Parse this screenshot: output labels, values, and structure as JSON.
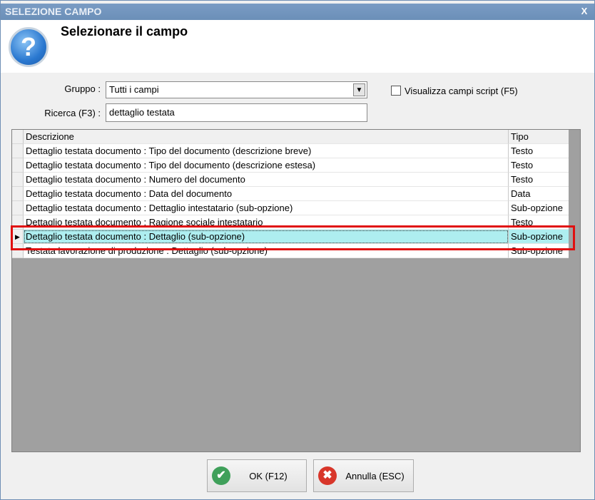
{
  "window": {
    "title": "SELEZIONE CAMPO",
    "close": "X"
  },
  "header": {
    "title": "Selezionare il campo",
    "icon": "question-icon",
    "icon_glyph": "?"
  },
  "form": {
    "group_label": "Gruppo :",
    "group_value": "Tutti i campi",
    "search_label": "Ricerca (F3) :",
    "search_value": "dettaglio testata",
    "script_label": "Visualizza campi script (F5)",
    "script_checked": false
  },
  "grid": {
    "columns": [
      "Descrizione",
      "Tipo"
    ],
    "rows": [
      [
        "Dettaglio testata documento : Tipo del documento (descrizione breve)",
        "Testo"
      ],
      [
        "Dettaglio testata documento : Tipo del documento (descrizione estesa)",
        "Testo"
      ],
      [
        "Dettaglio testata documento : Numero del documento",
        "Testo"
      ],
      [
        "Dettaglio testata documento : Data del documento",
        "Data"
      ],
      [
        "Dettaglio testata documento : Dettaglio intestatario (sub-opzione)",
        "Sub-opzione"
      ],
      [
        "Dettaglio testata documento : Ragione sociale intestatario",
        "Testo"
      ],
      [
        "Dettaglio testata documento : Dettaglio (sub-opzione)",
        "Sub-opzione"
      ],
      [
        "Testata lavorazione di produzione : Dettaglio (sub-opzione)",
        "Sub-opzione"
      ]
    ],
    "selected_index": 6,
    "current_marker": "▶"
  },
  "buttons": {
    "ok": "OK (F12)",
    "cancel": "Annulla (ESC)"
  },
  "colors": {
    "titlebar": "#6f95bd",
    "selected_row": "#aeeef0",
    "highlight": "#e01010",
    "ok": "#3fa05a",
    "cancel": "#d8362a"
  }
}
